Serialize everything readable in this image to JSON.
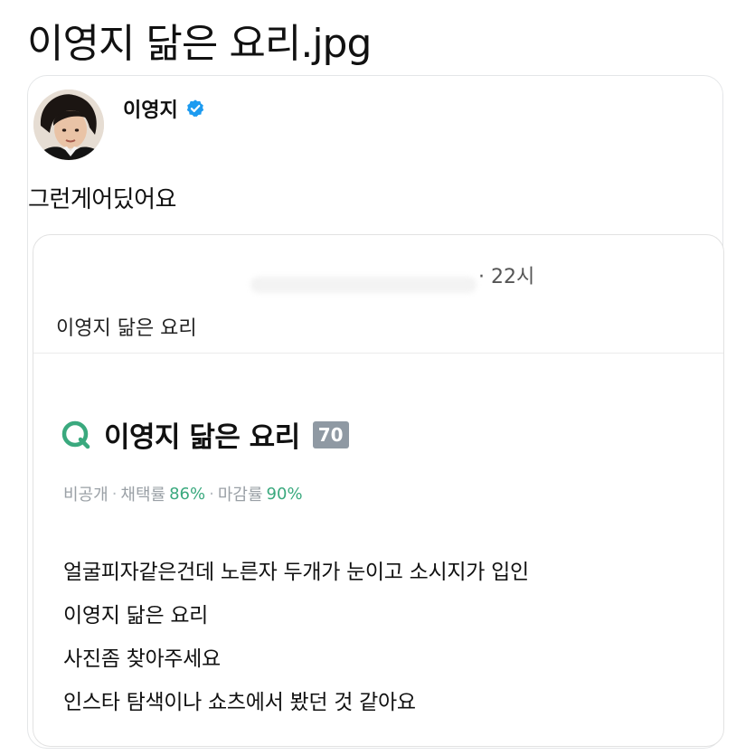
{
  "post": {
    "title": "이영지 닮은 요리.jpg"
  },
  "tweet": {
    "author_name": "이영지",
    "verified_icon": "verified-badge-icon",
    "text": "그런게어딨어요",
    "accent_color": "#1d9bf0"
  },
  "quote": {
    "meta": "· 22시",
    "text": "이영지 닮은 요리"
  },
  "qa": {
    "icon": "q-icon",
    "title": "이영지 닮은 요리",
    "badge": "70",
    "stats": {
      "visibility": "비공개",
      "adopt_label": "채택률",
      "adopt_value": "86%",
      "close_label": "마감률",
      "close_value": "90%"
    },
    "body_lines": [
      "얼굴피자같은건데 노른자 두개가 눈이고 소시지가 입인",
      "이영지 닮은 요리",
      "사진좀 찾아주세요",
      "인스타 탐색이나 쇼츠에서 봤던 것 같아요"
    ],
    "accent_color": "#3aa97e"
  }
}
